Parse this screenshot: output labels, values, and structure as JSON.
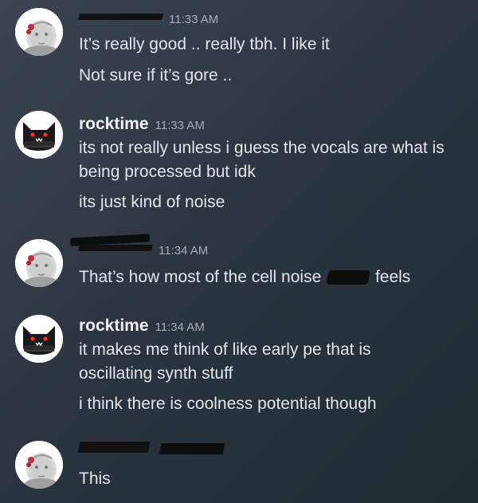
{
  "messages": [
    {
      "author": "",
      "author_redacted": true,
      "time": "11:33 AM",
      "lines": [
        "It’s really good .. really tbh. I like it",
        "Not sure if it’s gore .."
      ]
    },
    {
      "author": "rocktime",
      "author_redacted": false,
      "time": "11:33 AM",
      "lines": [
        "its not really unless i guess the vocals are what is",
        "being processed but idk",
        "its just kind of noise"
      ]
    },
    {
      "author": "",
      "author_redacted": true,
      "time": "11:34 AM",
      "lines": [
        "That’s how most of the cell noise",
        "feels"
      ]
    },
    {
      "author": "rocktime",
      "author_redacted": false,
      "time": "11:34 AM",
      "lines": [
        "it makes me think of like early pe that is",
        "oscillating synth stuff",
        "i think there is coolness potential though"
      ]
    },
    {
      "author": "",
      "author_redacted": true,
      "time": "",
      "lines": [
        "This"
      ]
    }
  ],
  "colors": {
    "text": "#e4e5e8",
    "username": "#f2f3f5",
    "timestamp": "#a9adb3",
    "redaction": "#0d0d0d"
  },
  "icons": {
    "user_avatar": "pale-face-avatar-icon",
    "rocktime_avatar": "black-cat-beanie-avatar-icon"
  }
}
